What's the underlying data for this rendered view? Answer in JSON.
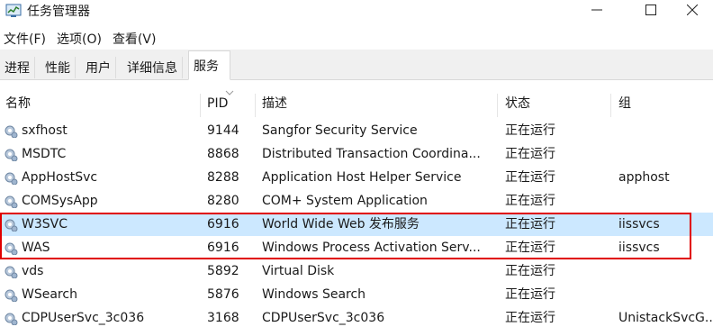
{
  "window": {
    "title": "任务管理器"
  },
  "menu": {
    "items": [
      "文件(F)",
      "选项(O)",
      "查看(V)"
    ]
  },
  "tabs": [
    "进程",
    "性能",
    "用户",
    "详细信息",
    "服务"
  ],
  "table": {
    "columns": [
      "名称",
      "PID",
      "描述",
      "状态",
      "组"
    ],
    "rows": [
      {
        "name": "sxfhost",
        "pid": "9144",
        "desc": "Sangfor Security Service",
        "status": "正在运行",
        "group": ""
      },
      {
        "name": "MSDTC",
        "pid": "8868",
        "desc": "Distributed Transaction Coordina...",
        "status": "正在运行",
        "group": ""
      },
      {
        "name": "AppHostSvc",
        "pid": "8288",
        "desc": "Application Host Helper Service",
        "status": "正在运行",
        "group": "apphost"
      },
      {
        "name": "COMSysApp",
        "pid": "8280",
        "desc": "COM+ System Application",
        "status": "正在运行",
        "group": ""
      },
      {
        "name": "W3SVC",
        "pid": "6916",
        "desc": "World Wide Web 发布服务",
        "status": "正在运行",
        "group": "iissvcs"
      },
      {
        "name": "WAS",
        "pid": "6916",
        "desc": "Windows Process Activation Serv...",
        "status": "正在运行",
        "group": "iissvcs"
      },
      {
        "name": "vds",
        "pid": "5892",
        "desc": "Virtual Disk",
        "status": "正在运行",
        "group": ""
      },
      {
        "name": "WSearch",
        "pid": "5876",
        "desc": "Windows Search",
        "status": "正在运行",
        "group": ""
      },
      {
        "name": "CDPUserSvc_3c036",
        "pid": "3168",
        "desc": "CDPUserSvc_3c036",
        "status": "正在运行",
        "group": "UnistackSvcG..."
      }
    ]
  }
}
